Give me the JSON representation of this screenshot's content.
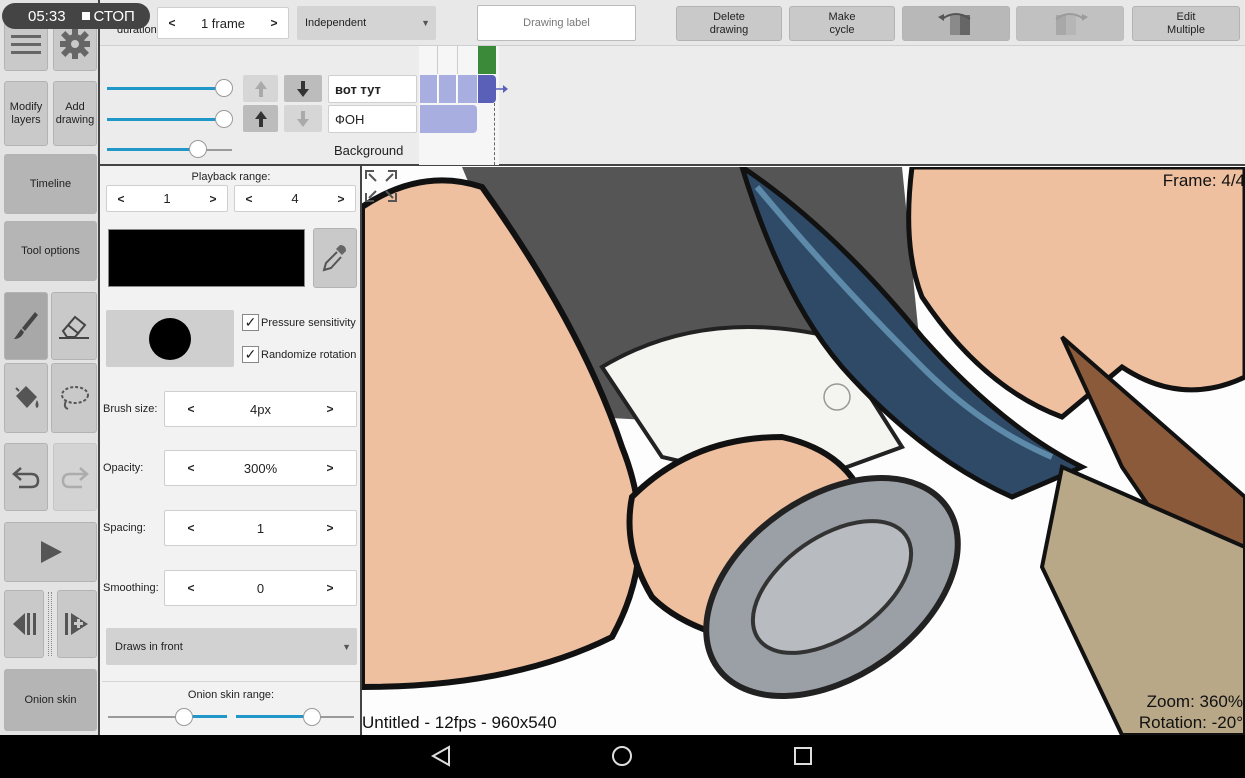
{
  "status": {
    "time": "05:33",
    "rec_label": "СТОП"
  },
  "toolbar": {
    "duration_label": "duration:",
    "frame_duration": "1 frame",
    "mode": "Independent",
    "drawing_label_placeholder": "Drawing label",
    "delete_drawing": "Delete drawing",
    "make_cycle": "Make cycle",
    "edit_multiple": "Edit Multiple",
    "prev_arrow": "<",
    "next_arrow": ">",
    "dropdown_arrow": "▼"
  },
  "left": {
    "modify_layers": "Modify layers",
    "add_drawing": "Add drawing",
    "timeline": "Timeline",
    "tool_options": "Tool options",
    "onion_skin": "Onion skin"
  },
  "layers": [
    {
      "name": "вот тут"
    },
    {
      "name": "ФОН"
    },
    {
      "name": "Background"
    }
  ],
  "options": {
    "playback_range_label": "Playback range:",
    "playback_start": "1",
    "playback_end": "4",
    "color": "#000000",
    "pressure_sensitivity": "Pressure sensitivity",
    "randomize_rotation": "Randomize rotation",
    "check_mark": "✓",
    "brush_size_label": "Brush size:",
    "brush_size": "4px",
    "opacity_label": "Opacity:",
    "opacity": "300%",
    "spacing_label": "Spacing:",
    "spacing": "1",
    "smoothing_label": "Smoothing:",
    "smoothing": "0",
    "draw_order": "Draws in front",
    "onion_range_label": "Onion skin range:"
  },
  "canvas": {
    "frame": "Frame: 4/4",
    "info": "Untitled - 12fps - 960x540",
    "zoom": "Zoom: 360%",
    "rotation": "Rotation: -20°"
  },
  "colors": {
    "accent": "#2196c8",
    "panel": "#e8e8e8",
    "button": "#c9c9c9",
    "frame_cell": "#a8aee0",
    "current_frame": "#3a8a3a"
  }
}
